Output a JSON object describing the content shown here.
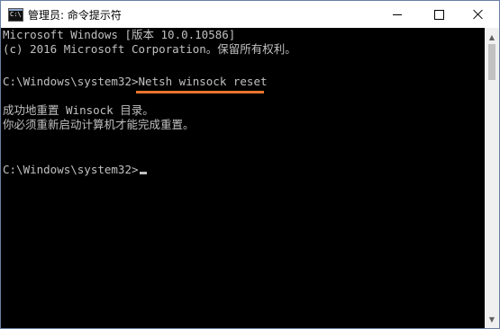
{
  "window": {
    "title": "管理员: 命令提示符",
    "app_icon": "cmd-icon",
    "app_icon_glyph": "C:\\"
  },
  "controls": {
    "minimize_icon": "minimize-icon",
    "maximize_icon": "maximize-icon",
    "close_icon": "close-icon"
  },
  "console": {
    "lines": [
      "Microsoft Windows [版本 10.0.10586]",
      "(c) 2016 Microsoft Corporation。保留所有权利。",
      "",
      "C:\\Windows\\system32>Netsh winsock reset",
      "",
      "成功地重置 Winsock 目录。",
      "你必须重新启动计算机才能完成重置。",
      "",
      "",
      "C:\\Windows\\system32>"
    ],
    "highlight_color": "#e8742e",
    "text_color": "#c0c0c0",
    "background_color": "#000000"
  },
  "scrollbar": {
    "up_icon": "scroll-up-icon",
    "down_icon": "scroll-down-icon"
  }
}
